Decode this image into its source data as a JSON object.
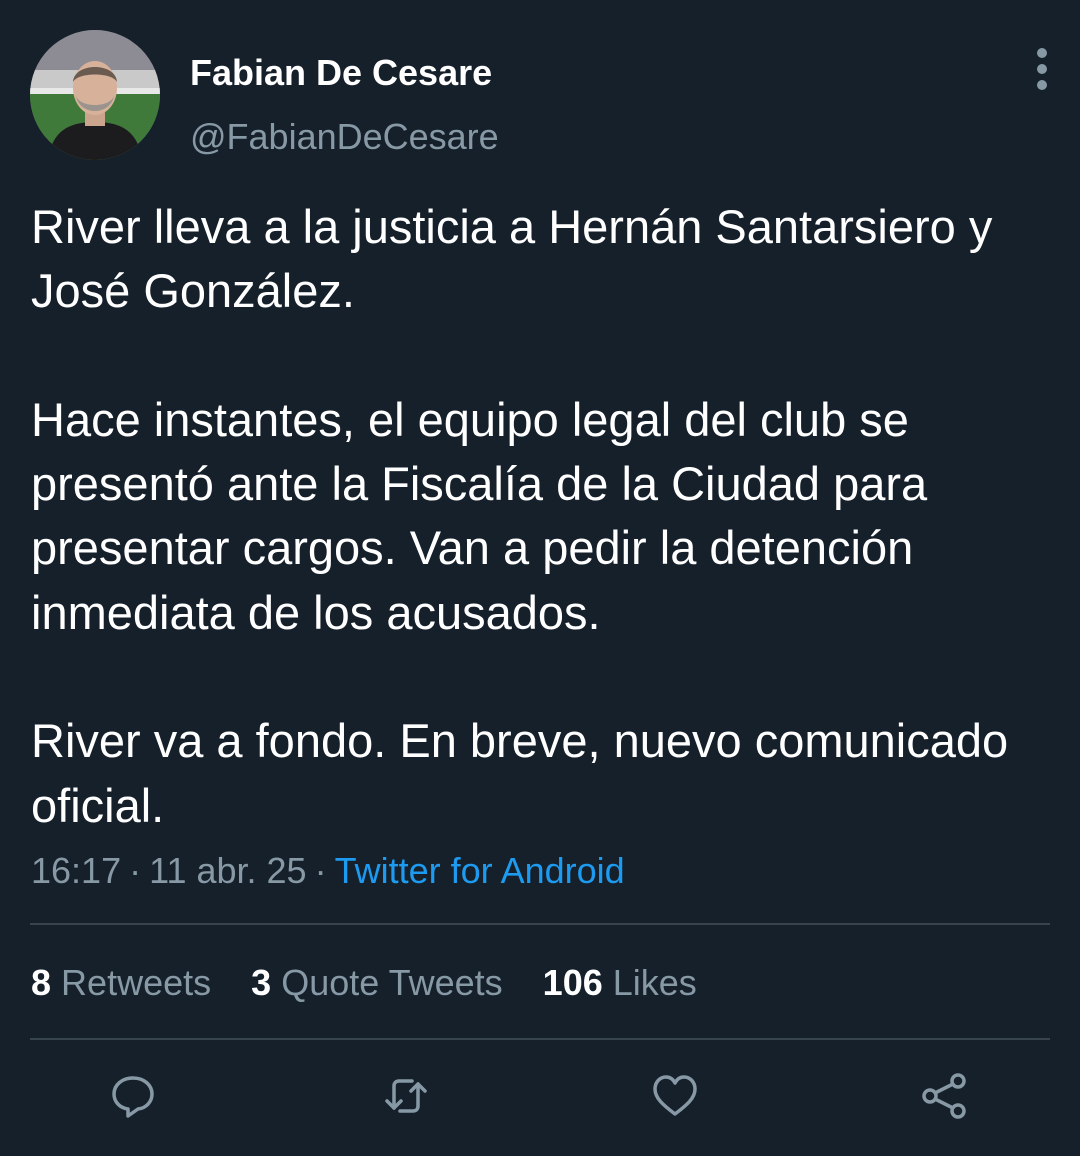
{
  "author": {
    "display_name": "Fabian De Cesare",
    "handle": "@FabianDeCesare"
  },
  "tweet": {
    "paragraphs": [
      "River lleva a la justicia a Hernán Santarsiero y José González.",
      "Hace instantes, el equipo legal del club se presentó ante la Fiscalía de la Ciudad para presentar cargos. Van a pedir la detención inmediata de los acusados.",
      "River va a fondo. En breve, nuevo comunicado oficial."
    ],
    "time": "16:17",
    "date": "11 abr. 25",
    "separator": "·",
    "source": "Twitter for Android"
  },
  "stats": {
    "retweets": {
      "count": "8",
      "label": "Retweets"
    },
    "quote_tweets": {
      "count": "3",
      "label": "Quote Tweets"
    },
    "likes": {
      "count": "106",
      "label": "Likes"
    }
  },
  "actions": {
    "reply_icon": "comment-bubble-icon",
    "retweet_icon": "retweet-arrows-icon",
    "like_icon": "heart-icon",
    "share_icon": "share-nodes-icon",
    "more_icon": "vertical-dots-icon"
  },
  "colors": {
    "background": "#15202b",
    "primary_text": "#ffffff",
    "secondary_text": "#8899a6",
    "link": "#1d9bf0",
    "divider": "#38444d"
  }
}
